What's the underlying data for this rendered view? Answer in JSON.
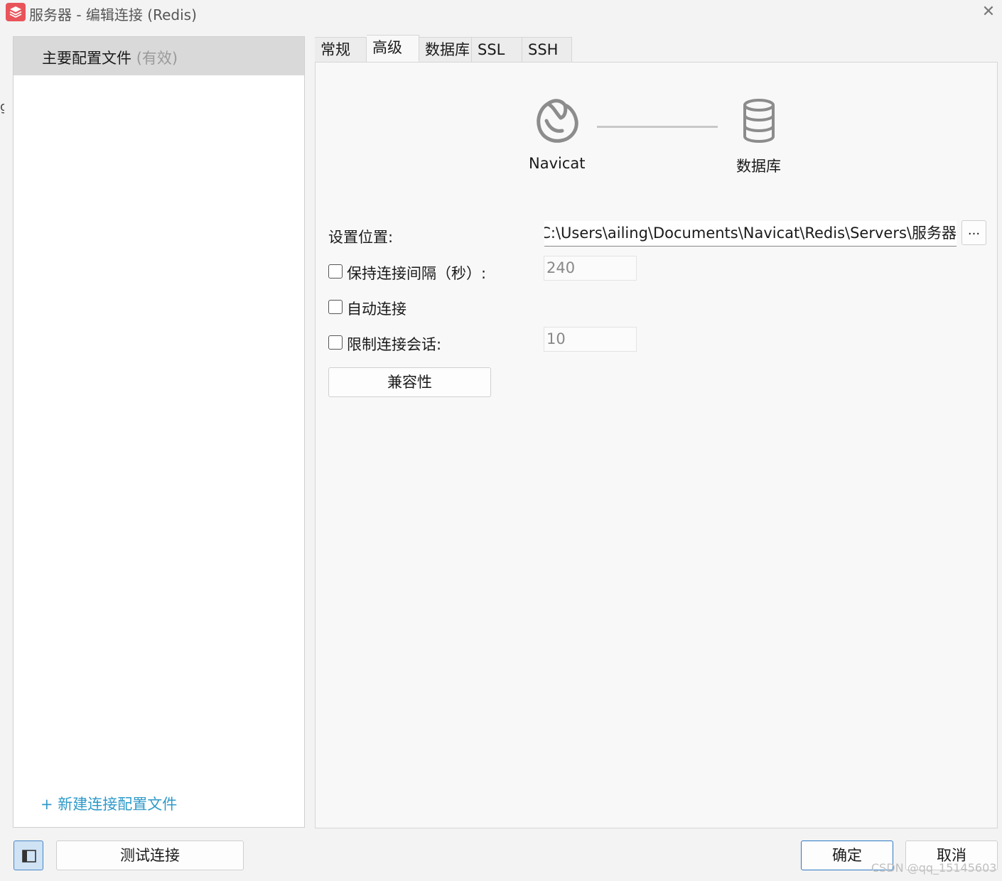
{
  "window": {
    "title": "服务器 - 编辑连接 (Redis)",
    "close_glyph": "✕"
  },
  "sidebar": {
    "profiles": [
      {
        "name": "主要配置文件",
        "status": "(有效)"
      }
    ],
    "new_profile_label": "+ 新建连接配置文件"
  },
  "tabs": [
    {
      "label": "常规",
      "active": false
    },
    {
      "label": "高级",
      "active": true
    },
    {
      "label": "数据库",
      "active": false
    },
    {
      "label": "SSL",
      "active": false
    },
    {
      "label": "SSH",
      "active": false
    }
  ],
  "diagram": {
    "left_label": "Navicat",
    "right_label": "数据库",
    "left_icon": "navicat-logo-icon",
    "right_icon": "database-icon"
  },
  "advanced": {
    "settings_location_label": "设置位置:",
    "settings_location_value": "C:\\Users\\ailing\\Documents\\Navicat\\Redis\\Servers\\服务器",
    "browse_label": "...",
    "keepalive_label": "保持连接间隔（秒）:",
    "keepalive_checked": false,
    "keepalive_value": "240",
    "auto_connect_label": "自动连接",
    "auto_connect_checked": false,
    "limit_sessions_label": "限制连接会话:",
    "limit_sessions_checked": false,
    "limit_sessions_value": "10",
    "compatibility_label": "兼容性"
  },
  "footer": {
    "test_connection_label": "测试连接",
    "ok_label": "确定",
    "cancel_label": "取消"
  },
  "watermark": "CSDN @qq_15145603",
  "colors": {
    "accent": "#2b79c2",
    "link": "#2f9ac9",
    "app_icon": "#e8545a"
  }
}
